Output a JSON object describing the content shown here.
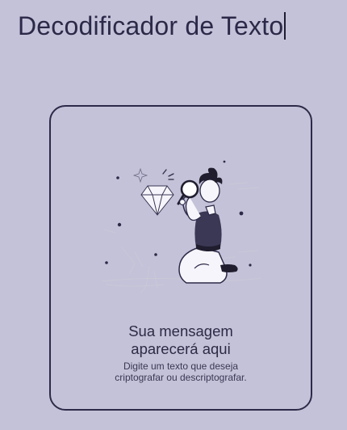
{
  "header": {
    "title": "Decodificador de Texto"
  },
  "output": {
    "illustration_icon": "person-with-magnifier-and-diamond-illustration",
    "empty_title_line1": "Sua mensagem",
    "empty_title_line2": "aparecerá aqui",
    "empty_hint_line1": "Digite um texto que deseja",
    "empty_hint_line2": "criptografar ou descriptografar."
  },
  "colors": {
    "background": "#c4c2d8",
    "text_primary": "#2b2948",
    "panel_border": "#2c2a48"
  }
}
